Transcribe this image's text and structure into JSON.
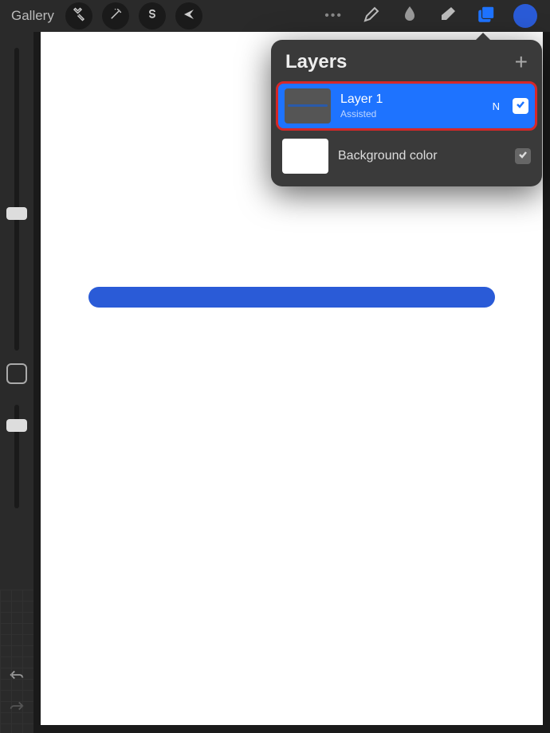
{
  "topbar": {
    "gallery_label": "Gallery"
  },
  "colors": {
    "active_color": "#2a5bd7",
    "layers_icon_active": "#1e73ff",
    "stroke_color": "#2a5bd7"
  },
  "layers_panel": {
    "title": "Layers",
    "layers": [
      {
        "name": "Layer 1",
        "subtitle": "Assisted",
        "blend": "N",
        "visible": true,
        "selected": true
      },
      {
        "name": "Background color",
        "subtitle": "",
        "blend": "",
        "visible": true,
        "selected": false
      }
    ]
  }
}
